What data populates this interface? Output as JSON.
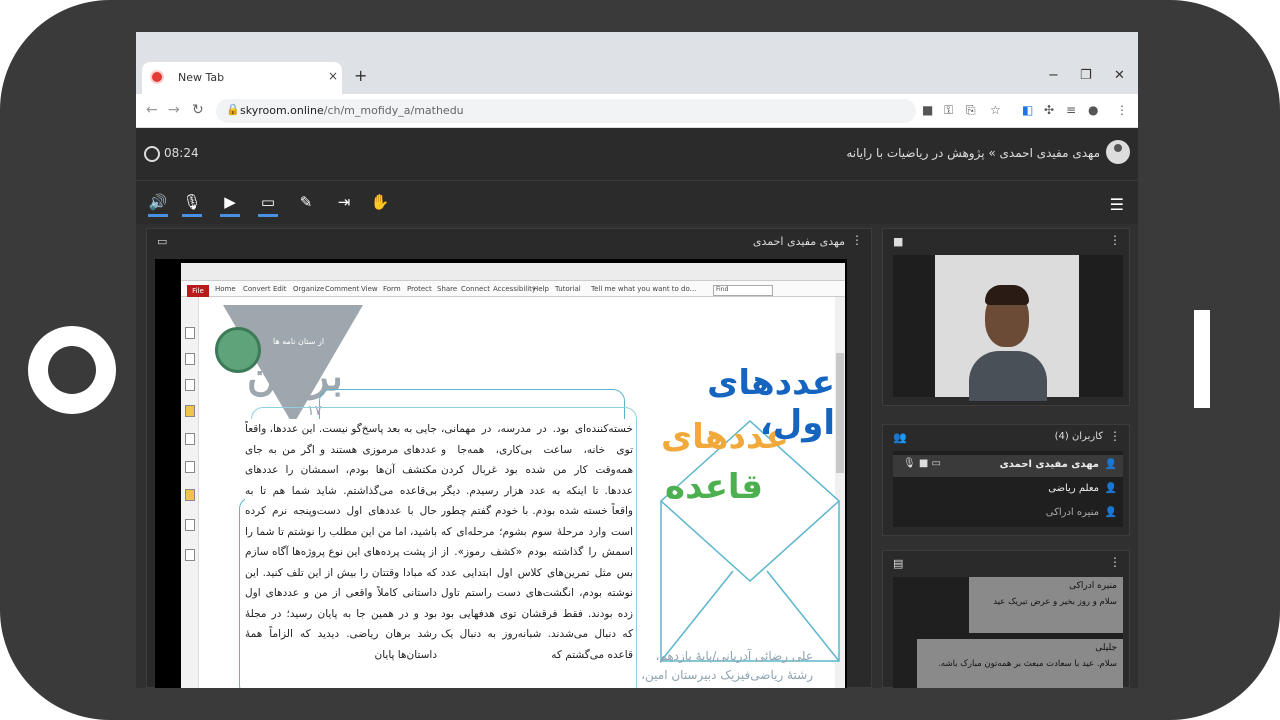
{
  "browser": {
    "tab_title": "New Tab",
    "tab_close": "×",
    "new_tab": "+",
    "url_domain": "skyroom.online",
    "url_path": "/ch/m_mofidy_a/mathedu",
    "controls": {
      "minimize": "−",
      "restore": "❐",
      "close": "✕"
    }
  },
  "app": {
    "timer": "08:24",
    "breadcrumb": "مهدی مفیدی احمدی » پژوهش در ریاضیات با رایانه"
  },
  "presentation": {
    "presenter": "مهدی مفیدی احمدی",
    "pdf_menu": [
      "Home",
      "Convert",
      "Edit",
      "Organize",
      "Comment",
      "View",
      "Form",
      "Protect",
      "Share",
      "Connect",
      "Accessibility",
      "Help",
      "Tutorial"
    ],
    "pdf_file_label": "File",
    "pdf_tell_me": "Tell me what you want to do...",
    "pdf_find": "Find",
    "magazine_logo": "برهان",
    "magazine_number": "۱۷",
    "magazine_subtitle": "از ستان نامه ها",
    "title_line1": "عددهای اول،",
    "title_line2": "عددهای",
    "title_line3": "قاعده",
    "author_line1": "علی رضائی آدریانی/پایهٔ یازدهم،",
    "author_line2": "رشتهٔ ریاضی‌فیزیک دبیرستان امین،",
    "column_right": "خسته‌کننده‌ای بود. در مدرسه، در مهمانی، توی خانه، ساعت بی‌کاری، همه‌جا و همه‌وقت کار من شده بود غربال کردن عددها. تا اینکه به عدد هزار رسیدم. دیگر واقعاً خسته شده بودم. با خودم گفتم چطور است وارد مرحلهٔ سوم بشوم؛ مرحله‌ای که اسمش را گذاشته بودم «کشف رموز». از بس مثل تمرین‌های کلاس اول ابتدایی عدد نوشته بودم، انگشت‌های دست راستم تاول زده بودند. فقط فرقشان توی هدفهایی بود که دنبال می‌شدند. شبانه‌روز به دنبال یک قاعده می‌گشتم که",
    "column_left": "جایی به بعد پاسخ‌گو نیست. این عددها، واقعاً عددهای مرموزی هستند و اگر من به جای مکتشف آن‌ها بودم، اسمشان را عددهای بی‌قاعده می‌گذاشتم. شاید شما هم تا به حال با عددهای اول دست‌وپنجه نرم کرده باشید، اما من این مطلب را نوشتم تا شما را از پشت پرده‌های این نوع پروژه‌ها آگاه سازم که مبادا وقتتان را بیش از این تلف کنید. این داستانی کاملاً واقعی از من و عددهای اول بود و در همین جا به پایان رسید؛ در مجلهٔ رشد برهان ریاضی. دیدید که الزاماً همهٔ داستان‌ها پایان"
  },
  "users_panel": {
    "title": "کاربران (4)",
    "users": [
      {
        "name": "مهدی مفیدی احمدی",
        "selected": true
      },
      {
        "name": "معلم ریاضی",
        "selected": false
      },
      {
        "name": "منیره ادراکی",
        "selected": false
      }
    ]
  },
  "chat_panel": {
    "messages": [
      {
        "name": "منیره ادراکی",
        "text": "سلام و روز بخیر و عرض تبریک عید"
      },
      {
        "name": "جلیلی",
        "text": "سلام. عید با سعادت مبعث بر همه‌تون مبارک باشه."
      }
    ]
  },
  "colors": {
    "accent_blue": "#4a90e2",
    "header_bg": "#2b2b2b",
    "title_blue": "#1565c0",
    "title_orange": "#f2a93b",
    "title_green": "#4caf50"
  },
  "icons": {
    "toolbar": [
      "speaker-icon",
      "microphone-icon",
      "camera-icon",
      "screen-share-icon",
      "pen-icon",
      "exit-icon",
      "raise-hand-icon"
    ]
  }
}
